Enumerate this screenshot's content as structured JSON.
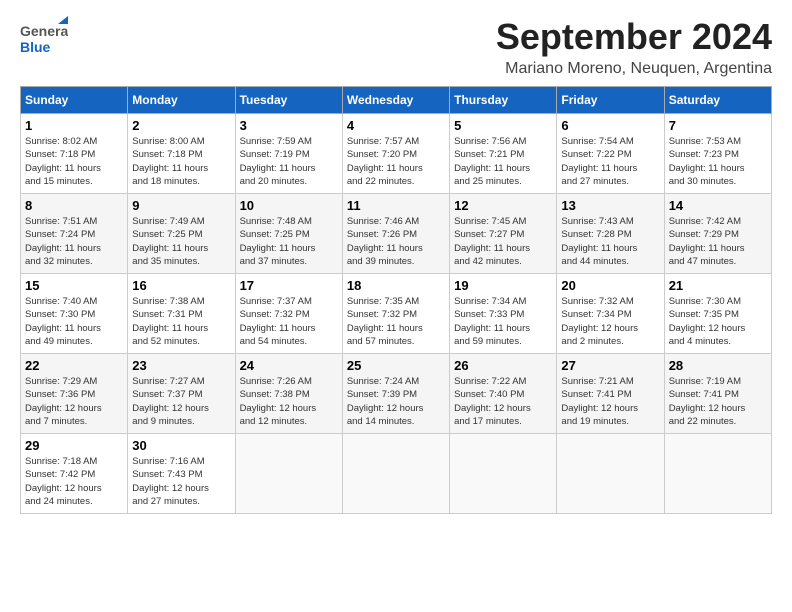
{
  "header": {
    "logo_line1": "General",
    "logo_line2": "Blue",
    "month": "September 2024",
    "location": "Mariano Moreno, Neuquen, Argentina"
  },
  "days_of_week": [
    "Sunday",
    "Monday",
    "Tuesday",
    "Wednesday",
    "Thursday",
    "Friday",
    "Saturday"
  ],
  "weeks": [
    [
      {
        "day": "1",
        "info": "Sunrise: 8:02 AM\nSunset: 7:18 PM\nDaylight: 11 hours\nand 15 minutes."
      },
      {
        "day": "2",
        "info": "Sunrise: 8:00 AM\nSunset: 7:18 PM\nDaylight: 11 hours\nand 18 minutes."
      },
      {
        "day": "3",
        "info": "Sunrise: 7:59 AM\nSunset: 7:19 PM\nDaylight: 11 hours\nand 20 minutes."
      },
      {
        "day": "4",
        "info": "Sunrise: 7:57 AM\nSunset: 7:20 PM\nDaylight: 11 hours\nand 22 minutes."
      },
      {
        "day": "5",
        "info": "Sunrise: 7:56 AM\nSunset: 7:21 PM\nDaylight: 11 hours\nand 25 minutes."
      },
      {
        "day": "6",
        "info": "Sunrise: 7:54 AM\nSunset: 7:22 PM\nDaylight: 11 hours\nand 27 minutes."
      },
      {
        "day": "7",
        "info": "Sunrise: 7:53 AM\nSunset: 7:23 PM\nDaylight: 11 hours\nand 30 minutes."
      }
    ],
    [
      {
        "day": "8",
        "info": "Sunrise: 7:51 AM\nSunset: 7:24 PM\nDaylight: 11 hours\nand 32 minutes."
      },
      {
        "day": "9",
        "info": "Sunrise: 7:49 AM\nSunset: 7:25 PM\nDaylight: 11 hours\nand 35 minutes."
      },
      {
        "day": "10",
        "info": "Sunrise: 7:48 AM\nSunset: 7:25 PM\nDaylight: 11 hours\nand 37 minutes."
      },
      {
        "day": "11",
        "info": "Sunrise: 7:46 AM\nSunset: 7:26 PM\nDaylight: 11 hours\nand 39 minutes."
      },
      {
        "day": "12",
        "info": "Sunrise: 7:45 AM\nSunset: 7:27 PM\nDaylight: 11 hours\nand 42 minutes."
      },
      {
        "day": "13",
        "info": "Sunrise: 7:43 AM\nSunset: 7:28 PM\nDaylight: 11 hours\nand 44 minutes."
      },
      {
        "day": "14",
        "info": "Sunrise: 7:42 AM\nSunset: 7:29 PM\nDaylight: 11 hours\nand 47 minutes."
      }
    ],
    [
      {
        "day": "15",
        "info": "Sunrise: 7:40 AM\nSunset: 7:30 PM\nDaylight: 11 hours\nand 49 minutes."
      },
      {
        "day": "16",
        "info": "Sunrise: 7:38 AM\nSunset: 7:31 PM\nDaylight: 11 hours\nand 52 minutes."
      },
      {
        "day": "17",
        "info": "Sunrise: 7:37 AM\nSunset: 7:32 PM\nDaylight: 11 hours\nand 54 minutes."
      },
      {
        "day": "18",
        "info": "Sunrise: 7:35 AM\nSunset: 7:32 PM\nDaylight: 11 hours\nand 57 minutes."
      },
      {
        "day": "19",
        "info": "Sunrise: 7:34 AM\nSunset: 7:33 PM\nDaylight: 11 hours\nand 59 minutes."
      },
      {
        "day": "20",
        "info": "Sunrise: 7:32 AM\nSunset: 7:34 PM\nDaylight: 12 hours\nand 2 minutes."
      },
      {
        "day": "21",
        "info": "Sunrise: 7:30 AM\nSunset: 7:35 PM\nDaylight: 12 hours\nand 4 minutes."
      }
    ],
    [
      {
        "day": "22",
        "info": "Sunrise: 7:29 AM\nSunset: 7:36 PM\nDaylight: 12 hours\nand 7 minutes."
      },
      {
        "day": "23",
        "info": "Sunrise: 7:27 AM\nSunset: 7:37 PM\nDaylight: 12 hours\nand 9 minutes."
      },
      {
        "day": "24",
        "info": "Sunrise: 7:26 AM\nSunset: 7:38 PM\nDaylight: 12 hours\nand 12 minutes."
      },
      {
        "day": "25",
        "info": "Sunrise: 7:24 AM\nSunset: 7:39 PM\nDaylight: 12 hours\nand 14 minutes."
      },
      {
        "day": "26",
        "info": "Sunrise: 7:22 AM\nSunset: 7:40 PM\nDaylight: 12 hours\nand 17 minutes."
      },
      {
        "day": "27",
        "info": "Sunrise: 7:21 AM\nSunset: 7:41 PM\nDaylight: 12 hours\nand 19 minutes."
      },
      {
        "day": "28",
        "info": "Sunrise: 7:19 AM\nSunset: 7:41 PM\nDaylight: 12 hours\nand 22 minutes."
      }
    ],
    [
      {
        "day": "29",
        "info": "Sunrise: 7:18 AM\nSunset: 7:42 PM\nDaylight: 12 hours\nand 24 minutes."
      },
      {
        "day": "30",
        "info": "Sunrise: 7:16 AM\nSunset: 7:43 PM\nDaylight: 12 hours\nand 27 minutes."
      },
      {
        "day": "",
        "info": ""
      },
      {
        "day": "",
        "info": ""
      },
      {
        "day": "",
        "info": ""
      },
      {
        "day": "",
        "info": ""
      },
      {
        "day": "",
        "info": ""
      }
    ]
  ]
}
